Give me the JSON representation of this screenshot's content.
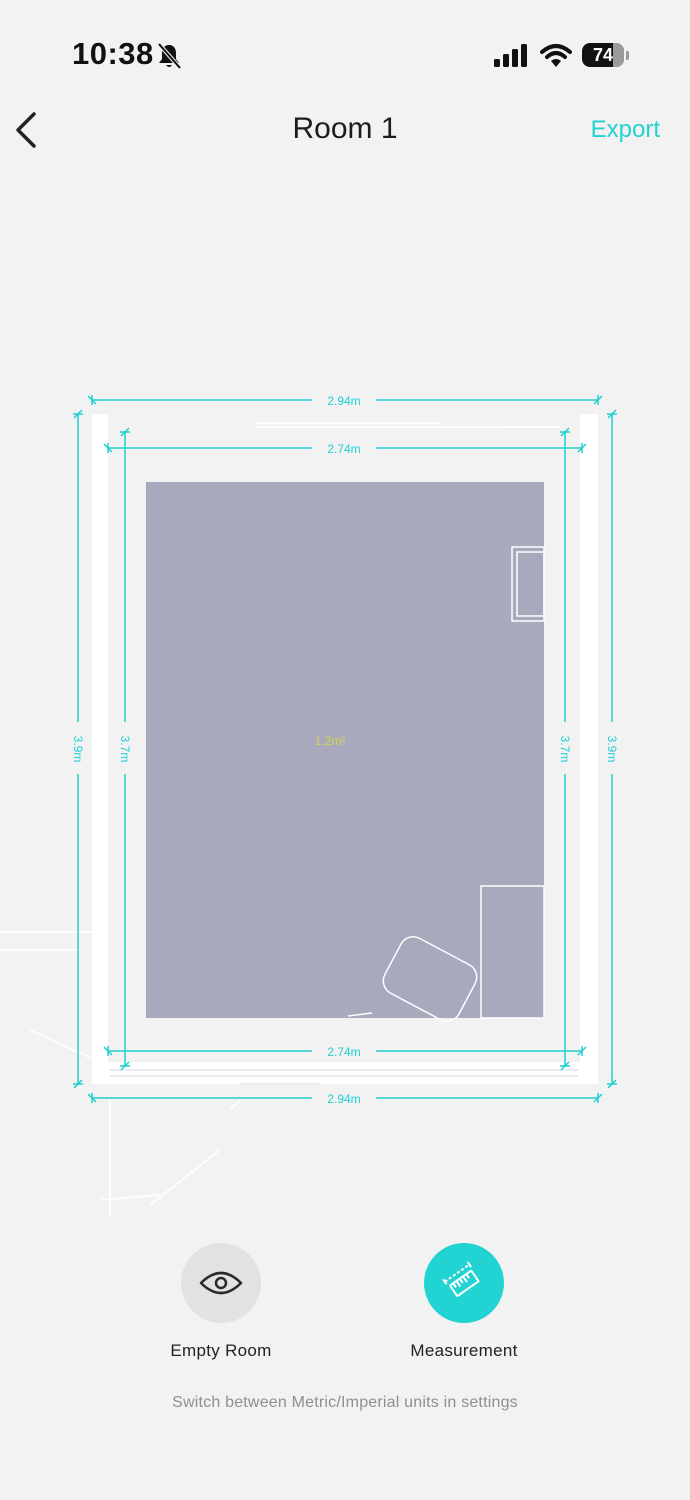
{
  "status_bar": {
    "time": "10:38",
    "battery_level": "74",
    "icons": [
      "bell-slash-icon",
      "cellular-signal-icon",
      "wifi-icon",
      "battery-icon"
    ]
  },
  "nav": {
    "title": "Room 1",
    "export_label": "Export",
    "back_icon": "chevron-left-icon"
  },
  "floorplan": {
    "outer_width_label": "2.94m",
    "inner_width_label": "2.74m",
    "outer_height_label": "3.9m",
    "inner_height_label": "3.7m",
    "area_label": "1.2m²"
  },
  "toolbar": {
    "empty_room_label": "Empty Room",
    "empty_room_icon": "eye-icon",
    "measurement_label": "Measurement",
    "measurement_icon": "ruler-icon"
  },
  "hint": "Switch between Metric/Imperial units in settings",
  "colors": {
    "accent": "#22d3d3",
    "room_fill": "#a8a9bd",
    "background": "#f2f2f3"
  }
}
